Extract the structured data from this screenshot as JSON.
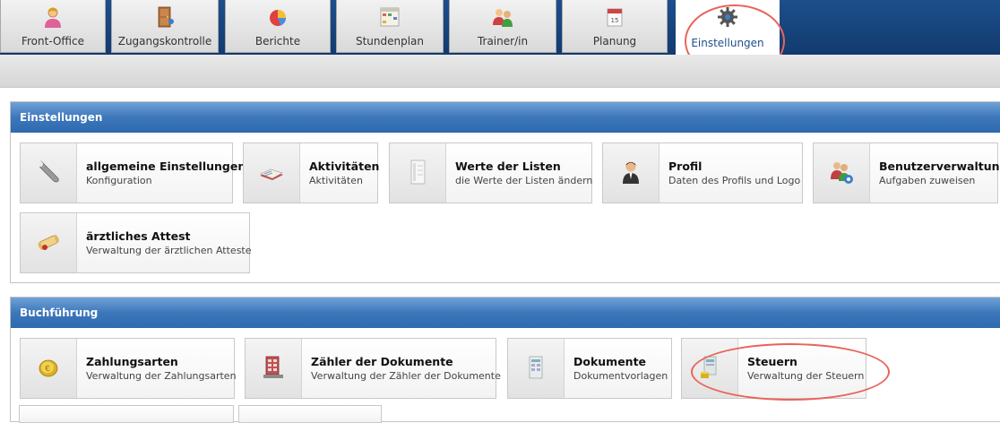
{
  "tabs": [
    {
      "label": "Front-Office",
      "icon": "user-icon"
    },
    {
      "label": "Zugangskontrolle",
      "icon": "door-icon"
    },
    {
      "label": "Berichte",
      "icon": "pie-chart-icon"
    },
    {
      "label": "Stundenplan",
      "icon": "calendar-grid-icon"
    },
    {
      "label": "Trainer/in",
      "icon": "users-icon"
    },
    {
      "label": "Planung",
      "icon": "calendar-icon"
    },
    {
      "label": "Einstellungen",
      "icon": "gear-icon",
      "active": true
    }
  ],
  "panels": {
    "einstellungen": {
      "title": "Einstellungen",
      "cards": [
        {
          "title": "allgemeine Einstellungen",
          "subtitle": "Konfiguration",
          "icon": "wrench-icon"
        },
        {
          "title": "Aktivitäten",
          "subtitle": "Aktivitäten",
          "icon": "book-icon"
        },
        {
          "title": "Werte der Listen",
          "subtitle": "die Werte der Listen ändern",
          "icon": "list-document-icon"
        },
        {
          "title": "Profil",
          "subtitle": "Daten des Profils und Logo",
          "icon": "person-icon"
        },
        {
          "title": "Benutzerverwaltung",
          "subtitle": "Aufgaben zuweisen",
          "icon": "users-gear-icon"
        },
        {
          "title": "ärztliches Attest",
          "subtitle": "Verwaltung der ärztlichen Atteste",
          "icon": "certificate-scroll-icon"
        }
      ]
    },
    "buchfuehrung": {
      "title": "Buchführung",
      "cards": [
        {
          "title": "Zahlungsarten",
          "subtitle": "Verwaltung der Zahlungsarten",
          "icon": "coin-icon"
        },
        {
          "title": "Zähler der Dokumente",
          "subtitle": "Verwaltung der Zähler der Dokumente",
          "icon": "counter-icon"
        },
        {
          "title": "Dokumente",
          "subtitle": "Dokumentvorlagen",
          "icon": "document-template-icon"
        },
        {
          "title": "Steuern",
          "subtitle": "Verwaltung der Steuern",
          "icon": "tax-document-icon"
        }
      ]
    }
  },
  "colors": {
    "tabbar": "#1d4f8c",
    "panel_header": "#3d77bb",
    "highlight": "#e8645a",
    "active_tab_text": "#1e4f8e"
  }
}
